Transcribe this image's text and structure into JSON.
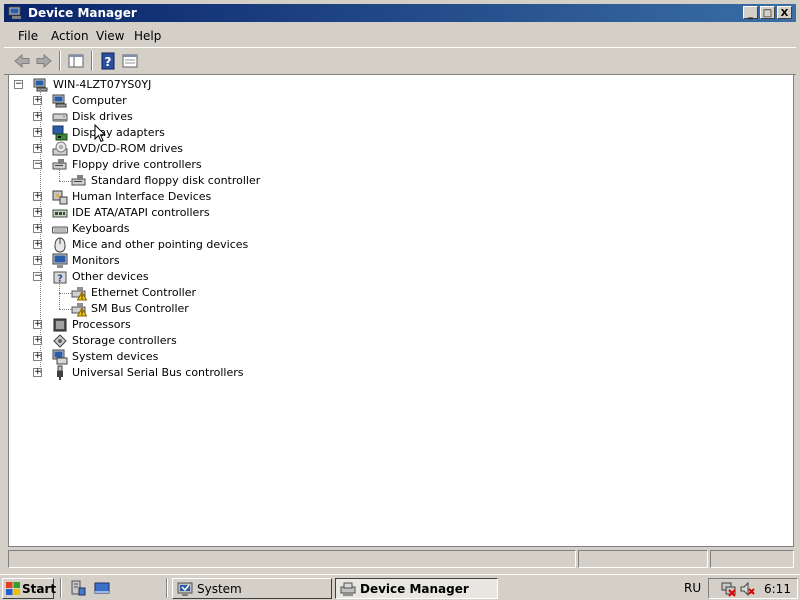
{
  "window": {
    "title": "Device Manager"
  },
  "title_buttons": {
    "minimize": "_",
    "maximize": "□",
    "close": "X"
  },
  "menu": [
    "File",
    "Action",
    "View",
    "Help"
  ],
  "toolbar": {
    "buttons": [
      "back-icon",
      "forward-icon",
      "console-tree-icon",
      "help-icon",
      "properties-icon"
    ]
  },
  "tree": {
    "root": {
      "label": "WIN-4LZT07YS0YJ",
      "icon": "computer-icon",
      "expanded": true
    },
    "categories": [
      {
        "label": "Computer",
        "icon": "computer-icon",
        "expanded": false
      },
      {
        "label": "Disk drives",
        "icon": "disk-drive-icon",
        "expanded": false
      },
      {
        "label": "Display adapters",
        "icon": "display-adapter-icon",
        "expanded": false
      },
      {
        "label": "DVD/CD-ROM drives",
        "icon": "dvd-icon",
        "expanded": false
      },
      {
        "label": "Floppy drive controllers",
        "icon": "floppy-controller-icon",
        "expanded": true,
        "children": [
          {
            "label": "Standard floppy disk controller",
            "icon": "floppy-controller-icon",
            "warning": false
          }
        ]
      },
      {
        "label": "Human Interface Devices",
        "icon": "hid-icon",
        "expanded": false
      },
      {
        "label": "IDE ATA/ATAPI controllers",
        "icon": "ide-controller-icon",
        "expanded": false
      },
      {
        "label": "Keyboards",
        "icon": "keyboard-icon",
        "expanded": false
      },
      {
        "label": "Mice and other pointing devices",
        "icon": "mouse-icon",
        "expanded": false
      },
      {
        "label": "Monitors",
        "icon": "monitor-icon",
        "expanded": false
      },
      {
        "label": "Other devices",
        "icon": "other-devices-icon",
        "expanded": true,
        "children": [
          {
            "label": "Ethernet Controller",
            "icon": "unknown-device-warning-icon",
            "warning": true
          },
          {
            "label": "SM Bus Controller",
            "icon": "unknown-device-warning-icon",
            "warning": true
          }
        ]
      },
      {
        "label": "Processors",
        "icon": "processor-icon",
        "expanded": false
      },
      {
        "label": "Storage controllers",
        "icon": "storage-controller-icon",
        "expanded": false
      },
      {
        "label": "System devices",
        "icon": "system-devices-icon",
        "expanded": false
      },
      {
        "label": "Universal Serial Bus controllers",
        "icon": "usb-icon",
        "expanded": false
      }
    ]
  },
  "taskbar": {
    "start_label": "Start",
    "quick_launch": [
      "server-manager-icon",
      "show-desktop-icon"
    ],
    "tasks": [
      {
        "label": "System",
        "icon": "system-icon",
        "active": false
      },
      {
        "label": "Device Manager",
        "icon": "device-manager-icon",
        "active": true
      }
    ],
    "language": "RU",
    "tray_icons": [
      "network-disconnected-icon",
      "volume-muted-icon"
    ],
    "clock": "6:11"
  },
  "colors": {
    "title_start": "#0a246a",
    "title_end": "#3a6ea5",
    "chrome": "#d4d0c8",
    "warning": "#f5d000"
  }
}
